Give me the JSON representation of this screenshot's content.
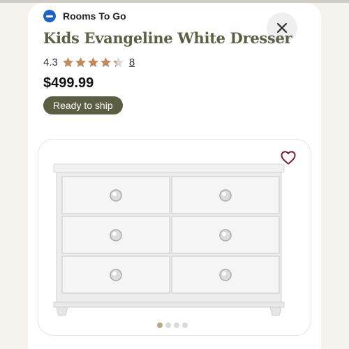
{
  "brand": {
    "name": "Rooms To Go"
  },
  "product": {
    "title": "Kids Evangeline White Dresser",
    "rating": "4.3",
    "rating_value": 4.3,
    "rating_max": 5,
    "review_count": "8",
    "price": "$499.99",
    "availability_badge": "Ready to ship"
  },
  "gallery": {
    "image_count": 4,
    "active_index": 0,
    "favorite_icon": "heart-outline-icon"
  },
  "icons": {
    "close": "close-icon",
    "brand_logo": "rooms-to-go-logo"
  },
  "colors": {
    "title": "#5b5f44",
    "badge_bg": "#5c5e44",
    "star": "#c08a5c",
    "heart": "#7a1f2b",
    "active_dot": "#b5ab86"
  }
}
